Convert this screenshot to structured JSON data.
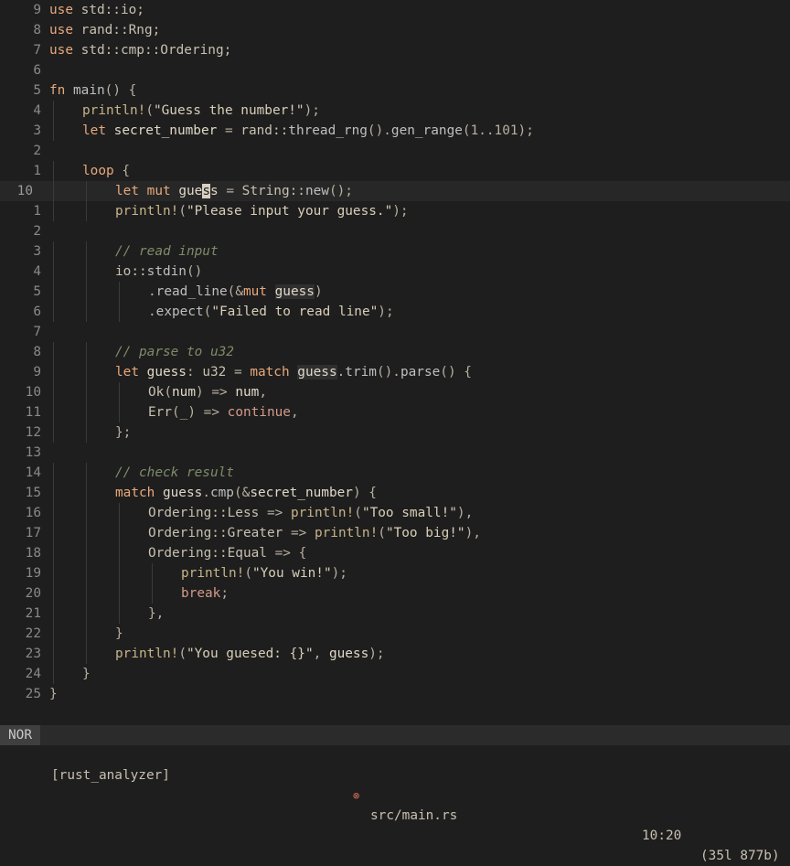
{
  "status_bar": {
    "mode": "NOR",
    "lsp": "[rust_analyzer]",
    "file_icon": "error-icon",
    "filename": "src/main.rs",
    "position": "10:20",
    "size": "(35l 877b)"
  },
  "lines": [
    {
      "num": "9",
      "segments": [
        {
          "t": "use ",
          "c": "kw"
        },
        {
          "t": "std::io;",
          "c": "path"
        }
      ]
    },
    {
      "num": "8",
      "segments": [
        {
          "t": "use ",
          "c": "kw"
        },
        {
          "t": "rand::Rng;",
          "c": "path"
        }
      ]
    },
    {
      "num": "7",
      "segments": [
        {
          "t": "use ",
          "c": "kw"
        },
        {
          "t": "std::cmp::Ordering;",
          "c": "path"
        }
      ]
    },
    {
      "num": "6",
      "segments": []
    },
    {
      "num": "5",
      "segments": [
        {
          "t": "fn ",
          "c": "kw"
        },
        {
          "t": "main",
          "c": "fn"
        },
        {
          "t": "() {",
          "c": "pn"
        }
      ]
    },
    {
      "num": "4",
      "indent": 1,
      "segments": [
        {
          "t": "println!",
          "c": "mac"
        },
        {
          "t": "(",
          "c": "pn"
        },
        {
          "t": "\"Guess the number!\"",
          "c": "str"
        },
        {
          "t": ");",
          "c": "pn"
        }
      ]
    },
    {
      "num": "3",
      "indent": 1,
      "segments": [
        {
          "t": "let ",
          "c": "kw"
        },
        {
          "t": "secret_number",
          "c": "var"
        },
        {
          "t": " = ",
          "c": "pn"
        },
        {
          "t": "rand::",
          "c": "path"
        },
        {
          "t": "thread_rng",
          "c": "fn"
        },
        {
          "t": "().",
          "c": "pn"
        },
        {
          "t": "gen_range",
          "c": "fn"
        },
        {
          "t": "(1..101);",
          "c": "pn"
        }
      ]
    },
    {
      "num": "2",
      "segments": []
    },
    {
      "num": "1",
      "indent": 1,
      "segments": [
        {
          "t": "loop ",
          "c": "kw"
        },
        {
          "t": "{",
          "c": "pn"
        }
      ]
    },
    {
      "num": "10",
      "current": true,
      "indent": 2,
      "segments": [
        {
          "t": "let ",
          "c": "kw"
        },
        {
          "t": "mut ",
          "c": "kw"
        },
        {
          "t": "gue",
          "c": "var"
        },
        {
          "t": "s",
          "c": "cursor"
        },
        {
          "t": "s",
          "c": "var"
        },
        {
          "t": " = ",
          "c": "pn"
        },
        {
          "t": "String::",
          "c": "ty"
        },
        {
          "t": "new",
          "c": "fn"
        },
        {
          "t": "();",
          "c": "pn"
        }
      ]
    },
    {
      "num": "1",
      "indent": 2,
      "segments": [
        {
          "t": "println!",
          "c": "mac"
        },
        {
          "t": "(",
          "c": "pn"
        },
        {
          "t": "\"Please input your guess.\"",
          "c": "str"
        },
        {
          "t": ");",
          "c": "pn"
        }
      ]
    },
    {
      "num": "2",
      "segments": []
    },
    {
      "num": "3",
      "indent": 2,
      "segments": [
        {
          "t": "// read input",
          "c": "cm"
        }
      ]
    },
    {
      "num": "4",
      "indent": 2,
      "segments": [
        {
          "t": "io::",
          "c": "path"
        },
        {
          "t": "stdin",
          "c": "fn"
        },
        {
          "t": "()",
          "c": "pn"
        }
      ]
    },
    {
      "num": "5",
      "indent": 3,
      "segments": [
        {
          "t": ".",
          "c": "pn"
        },
        {
          "t": "read_line",
          "c": "fn"
        },
        {
          "t": "(&",
          "c": "pn"
        },
        {
          "t": "mut ",
          "c": "kw"
        },
        {
          "t": "guess",
          "c": "hl"
        },
        {
          "t": ")",
          "c": "pn"
        }
      ]
    },
    {
      "num": "6",
      "indent": 3,
      "segments": [
        {
          "t": ".",
          "c": "pn"
        },
        {
          "t": "expect",
          "c": "fn"
        },
        {
          "t": "(",
          "c": "pn"
        },
        {
          "t": "\"Failed to read line\"",
          "c": "str"
        },
        {
          "t": ");",
          "c": "pn"
        }
      ]
    },
    {
      "num": "7",
      "segments": []
    },
    {
      "num": "8",
      "indent": 2,
      "segments": [
        {
          "t": "// parse to u32",
          "c": "cm"
        }
      ]
    },
    {
      "num": "9",
      "indent": 2,
      "segments": [
        {
          "t": "let ",
          "c": "kw"
        },
        {
          "t": "guess",
          "c": "var"
        },
        {
          "t": ": ",
          "c": "pn"
        },
        {
          "t": "u32",
          "c": "ty"
        },
        {
          "t": " = ",
          "c": "pn"
        },
        {
          "t": "match ",
          "c": "kw"
        },
        {
          "t": "guess",
          "c": "hl"
        },
        {
          "t": ".",
          "c": "pn"
        },
        {
          "t": "trim",
          "c": "fn"
        },
        {
          "t": "().",
          "c": "pn"
        },
        {
          "t": "parse",
          "c": "fn"
        },
        {
          "t": "() {",
          "c": "pn"
        }
      ]
    },
    {
      "num": "10",
      "indent": 3,
      "segments": [
        {
          "t": "Ok",
          "c": "ty"
        },
        {
          "t": "(",
          "c": "pn"
        },
        {
          "t": "num",
          "c": "var"
        },
        {
          "t": ") => ",
          "c": "pn"
        },
        {
          "t": "num",
          "c": "var"
        },
        {
          "t": ",",
          "c": "pn"
        }
      ]
    },
    {
      "num": "11",
      "indent": 3,
      "segments": [
        {
          "t": "Err",
          "c": "ty"
        },
        {
          "t": "(_) => ",
          "c": "pn"
        },
        {
          "t": "continue",
          "c": "kw2"
        },
        {
          "t": ",",
          "c": "pn"
        }
      ]
    },
    {
      "num": "12",
      "indent": 2,
      "segments": [
        {
          "t": "};",
          "c": "pn"
        }
      ]
    },
    {
      "num": "13",
      "segments": []
    },
    {
      "num": "14",
      "indent": 2,
      "segments": [
        {
          "t": "// check result",
          "c": "cm"
        }
      ]
    },
    {
      "num": "15",
      "indent": 2,
      "segments": [
        {
          "t": "match ",
          "c": "kw"
        },
        {
          "t": "guess",
          "c": "var"
        },
        {
          "t": ".",
          "c": "pn"
        },
        {
          "t": "cmp",
          "c": "fn"
        },
        {
          "t": "(&",
          "c": "pn"
        },
        {
          "t": "secret_number",
          "c": "var"
        },
        {
          "t": ") {",
          "c": "pn"
        }
      ]
    },
    {
      "num": "16",
      "indent": 3,
      "segments": [
        {
          "t": "Ordering::Less",
          "c": "ty"
        },
        {
          "t": " => ",
          "c": "pn"
        },
        {
          "t": "println!",
          "c": "mac"
        },
        {
          "t": "(",
          "c": "pn"
        },
        {
          "t": "\"Too small!\"",
          "c": "str"
        },
        {
          "t": "),",
          "c": "pn"
        }
      ]
    },
    {
      "num": "17",
      "indent": 3,
      "segments": [
        {
          "t": "Ordering::Greater",
          "c": "ty"
        },
        {
          "t": " => ",
          "c": "pn"
        },
        {
          "t": "println!",
          "c": "mac"
        },
        {
          "t": "(",
          "c": "pn"
        },
        {
          "t": "\"Too big!\"",
          "c": "str"
        },
        {
          "t": "),",
          "c": "pn"
        }
      ]
    },
    {
      "num": "18",
      "indent": 3,
      "segments": [
        {
          "t": "Ordering::Equal",
          "c": "ty"
        },
        {
          "t": " => {",
          "c": "pn"
        }
      ]
    },
    {
      "num": "19",
      "indent": 4,
      "segments": [
        {
          "t": "println!",
          "c": "mac"
        },
        {
          "t": "(",
          "c": "pn"
        },
        {
          "t": "\"You win!\"",
          "c": "str"
        },
        {
          "t": ");",
          "c": "pn"
        }
      ]
    },
    {
      "num": "20",
      "indent": 4,
      "segments": [
        {
          "t": "break",
          "c": "kw2"
        },
        {
          "t": ";",
          "c": "pn"
        }
      ]
    },
    {
      "num": "21",
      "indent": 3,
      "segments": [
        {
          "t": "},",
          "c": "pn"
        }
      ]
    },
    {
      "num": "22",
      "indent": 2,
      "segments": [
        {
          "t": "}",
          "c": "pn"
        }
      ]
    },
    {
      "num": "23",
      "indent": 2,
      "segments": [
        {
          "t": "println!",
          "c": "mac"
        },
        {
          "t": "(",
          "c": "pn"
        },
        {
          "t": "\"You guesed: {}\"",
          "c": "str"
        },
        {
          "t": ", ",
          "c": "pn"
        },
        {
          "t": "guess",
          "c": "var"
        },
        {
          "t": ");",
          "c": "pn"
        }
      ]
    },
    {
      "num": "24",
      "indent": 1,
      "segments": [
        {
          "t": "}",
          "c": "pn"
        }
      ]
    },
    {
      "num": "25",
      "segments": [
        {
          "t": "}",
          "c": "pn"
        }
      ]
    }
  ]
}
